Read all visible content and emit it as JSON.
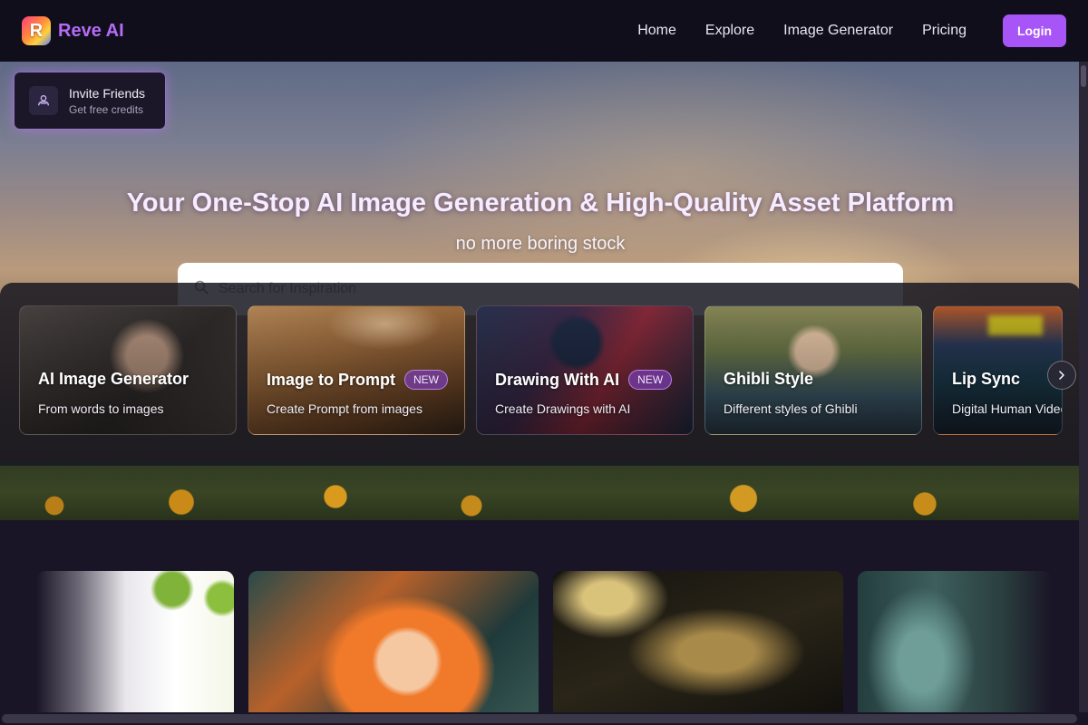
{
  "header": {
    "logo_letter": "R",
    "brand": "Reve AI",
    "nav": [
      {
        "label": "Home"
      },
      {
        "label": "Explore"
      },
      {
        "label": "Image Generator"
      },
      {
        "label": "Pricing"
      }
    ],
    "login_label": "Login",
    "brand_color": "#b46cf7",
    "accent_color": "#a855f7"
  },
  "invite": {
    "title": "Invite Friends",
    "subtitle": "Get free credits",
    "icon": "users-icon"
  },
  "hero": {
    "title": "Your One-Stop AI Image Generation & High-Quality Asset Platform",
    "subtitle": "no more boring stock"
  },
  "search": {
    "placeholder": "Search for Inspiration",
    "value": "",
    "icon": "search-icon"
  },
  "features": [
    {
      "title": "AI Image Generator",
      "subtitle": "From words to images",
      "badge": ""
    },
    {
      "title": "Image to Prompt",
      "subtitle": "Create Prompt from images",
      "badge": "NEW"
    },
    {
      "title": "Drawing With AI",
      "subtitle": "Create Drawings with AI",
      "badge": "NEW"
    },
    {
      "title": "Ghibli Style",
      "subtitle": "Different styles of Ghibli",
      "badge": ""
    },
    {
      "title": "Lip Sync",
      "subtitle": "Digital Human Video",
      "badge": ""
    }
  ],
  "carousel_next_icon": "chevron-right-icon"
}
